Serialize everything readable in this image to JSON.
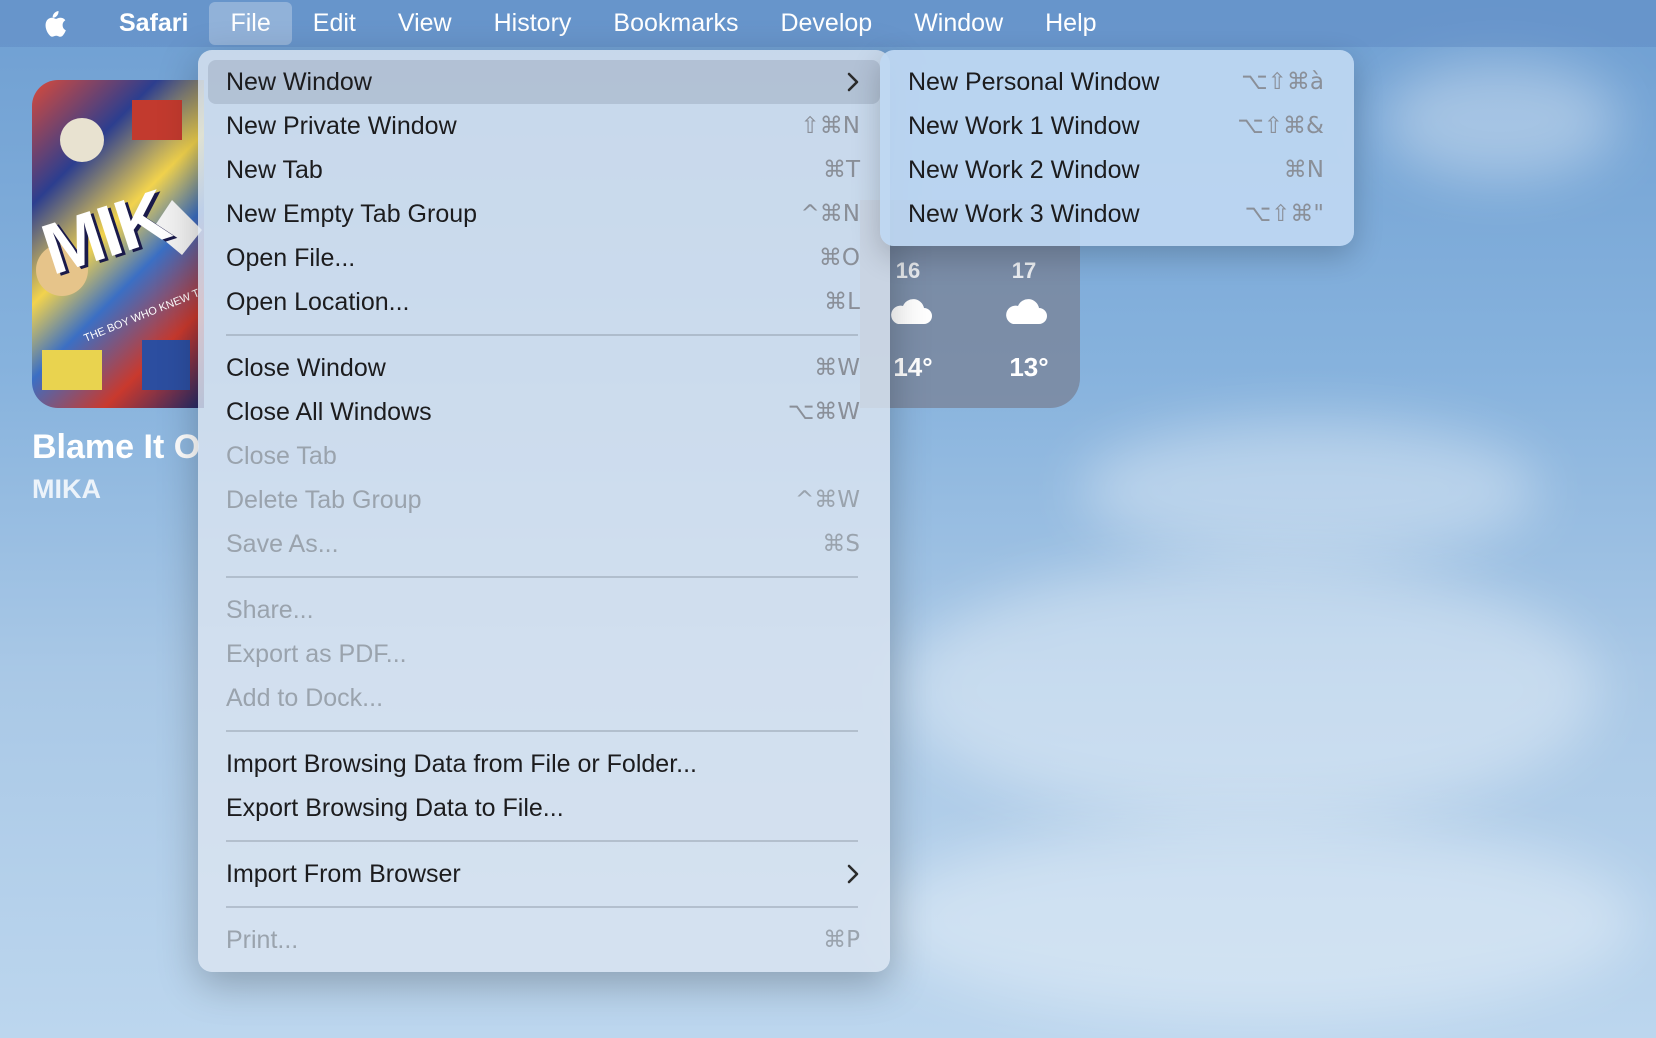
{
  "menubar": {
    "app_name": "Safari",
    "items": [
      "File",
      "Edit",
      "View",
      "History",
      "Bookmarks",
      "Develop",
      "Window",
      "Help"
    ]
  },
  "now_playing": {
    "album_text": "MIK",
    "album_subtext": "THE BOY WHO KNEW T",
    "title": "Blame It On",
    "artist": "MIKA"
  },
  "weather": {
    "days": [
      "16",
      "17"
    ],
    "temps": [
      "14°",
      "13°"
    ],
    "icons": [
      "cloud-icon",
      "cloud-icon"
    ]
  },
  "file_menu": {
    "items": [
      {
        "label": "New Window",
        "shortcut": "",
        "submenu": true,
        "disabled": false
      },
      {
        "label": "New Private Window",
        "shortcut": "⇧⌘N",
        "disabled": false
      },
      {
        "label": "New Tab",
        "shortcut": "⌘T",
        "disabled": false
      },
      {
        "label": "New Empty Tab Group",
        "shortcut": "^⌘N",
        "disabled": false
      },
      {
        "label": "Open File...",
        "shortcut": "⌘O",
        "disabled": false
      },
      {
        "label": "Open Location...",
        "shortcut": "⌘L",
        "disabled": false
      },
      {
        "label": "Close Window",
        "shortcut": "⌘W",
        "disabled": false
      },
      {
        "label": "Close All Windows",
        "shortcut": "⌥⌘W",
        "disabled": false
      },
      {
        "label": "Close Tab",
        "shortcut": "",
        "disabled": true
      },
      {
        "label": "Delete Tab Group",
        "shortcut": "^⌘W",
        "disabled": true
      },
      {
        "label": "Save As...",
        "shortcut": "⌘S",
        "disabled": true
      },
      {
        "label": "Share...",
        "shortcut": "",
        "disabled": true
      },
      {
        "label": "Export as PDF...",
        "shortcut": "",
        "disabled": true
      },
      {
        "label": "Add to Dock...",
        "shortcut": "",
        "disabled": true
      },
      {
        "label": "Import Browsing Data from File or Folder...",
        "shortcut": "",
        "disabled": false
      },
      {
        "label": "Export Browsing Data to File...",
        "shortcut": "",
        "disabled": false
      },
      {
        "label": "Import From Browser",
        "shortcut": "",
        "submenu": true,
        "disabled": false
      },
      {
        "label": "Print...",
        "shortcut": "⌘P",
        "disabled": true
      }
    ]
  },
  "new_window_submenu": {
    "items": [
      {
        "label": "New Personal Window",
        "shortcut": "⌥⇧⌘à"
      },
      {
        "label": "New Work 1 Window",
        "shortcut": "⌥⇧⌘&"
      },
      {
        "label": "New Work 2 Window",
        "shortcut": "⌘N"
      },
      {
        "label": "New Work 3 Window",
        "shortcut": "⌥⇧⌘\""
      }
    ]
  }
}
